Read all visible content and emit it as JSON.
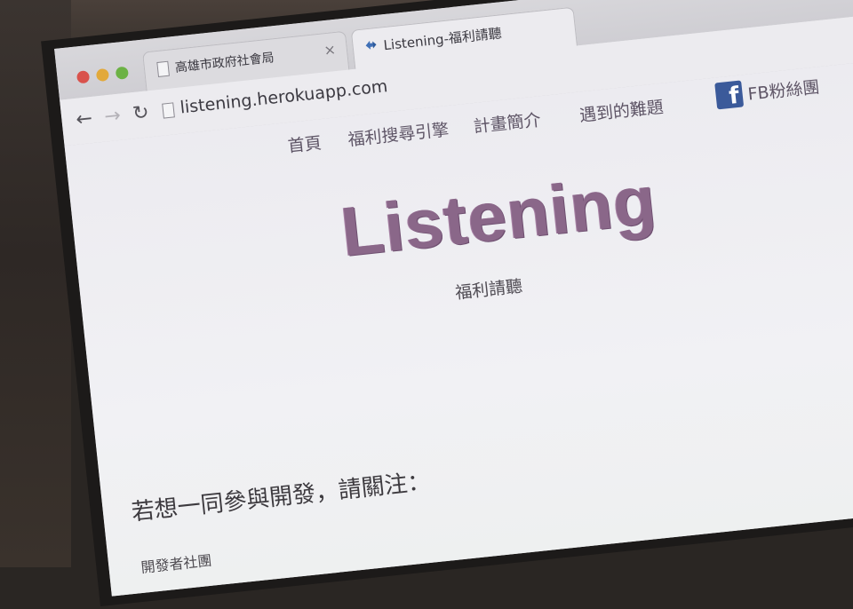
{
  "browser": {
    "tabs": [
      {
        "title": "高雄市政府社會局",
        "close": "×"
      },
      {
        "title": "Listening-福利請聽"
      }
    ],
    "url": "listening.herokuapp.com"
  },
  "site": {
    "nav": {
      "home": "首頁",
      "search": "福利搜尋引擎",
      "about": "計畫簡介",
      "issues": "遇到的難題",
      "fb": "FB粉絲團"
    },
    "logo_title": "Listening",
    "logo_subtitle": "福利請聽",
    "join_heading": "若想一同參與開發，請關注：",
    "dev_community": "開發者社團"
  },
  "icons": {
    "back": "arrow-left-icon",
    "forward": "arrow-right-icon",
    "reload": "reload-icon",
    "facebook": "facebook-icon"
  },
  "colors": {
    "logo": "#8a6789",
    "facebook": "#3b5a9a"
  }
}
